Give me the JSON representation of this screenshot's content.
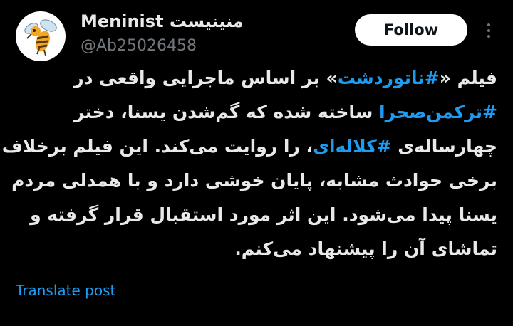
{
  "author": {
    "display_name": "Meninist منینیست",
    "handle": "@Ab25026458",
    "avatar_icon": "bee-icon"
  },
  "actions": {
    "follow_label": "Follow",
    "more_icon": "more-vertical-icon"
  },
  "post": {
    "lines": [
      [
        {
          "t": "فیلم «"
        },
        {
          "t": "#ناتوردشت",
          "tag": true
        },
        {
          "t": "» بر اساس ماجرایی واقعی در"
        }
      ],
      [
        {
          "t": "#ترکمن‌صحرا",
          "tag": true
        },
        {
          "t": " ساخته شده که گم‌شدن یسنا، دختر"
        }
      ],
      [
        {
          "t": "چهارساله‌ی "
        },
        {
          "t": "#کلاله‌ای",
          "tag": true
        },
        {
          "t": "، را روایت می‌کند. این فیلم برخلاف"
        }
      ],
      [
        {
          "t": "برخی حوادث مشابه، پایان خوشی دارد و با همدلی مردم"
        }
      ],
      [
        {
          "t": "یسنا پیدا می‌شود. این اثر مورد استقبال قرار گرفته و"
        }
      ],
      [
        {
          "t": "تماشای آن را پیشنهاد می‌کنم."
        }
      ]
    ]
  },
  "translate_label": "Translate post",
  "colors": {
    "background": "#000000",
    "text": "#e7e9ea",
    "secondary": "#71767b",
    "link": "#1d9bf0"
  }
}
